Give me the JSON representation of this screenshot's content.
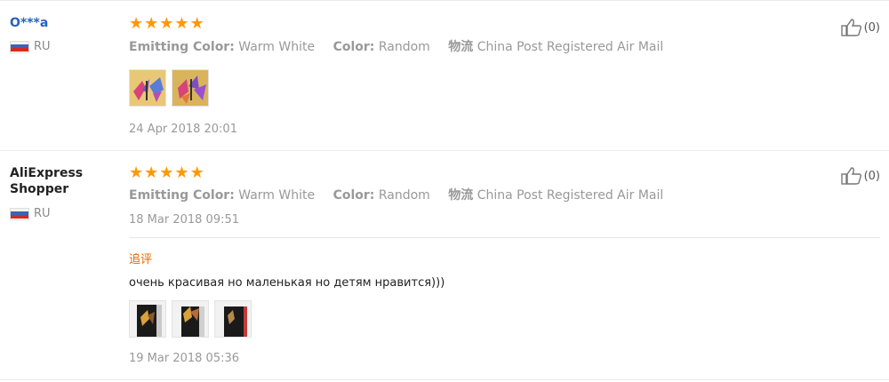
{
  "reviews": [
    {
      "user": "O***a",
      "country": "RU",
      "stars": 5,
      "attributes": [
        {
          "key": "Emitting Color:",
          "value": "Warm White"
        },
        {
          "key": "Color:",
          "value": "Random"
        },
        {
          "key": "物流",
          "value": "China Post Registered Air Mail"
        }
      ],
      "date": "24 Apr 2018 20:01",
      "helpful_count": "(0)",
      "images": [
        "butterfly-photo-1",
        "butterfly-photo-2"
      ]
    },
    {
      "user": "AliExpress Shopper",
      "country": "RU",
      "stars": 5,
      "attributes": [
        {
          "key": "Emitting Color:",
          "value": "Warm White"
        },
        {
          "key": "Color:",
          "value": "Random"
        },
        {
          "key": "物流",
          "value": "China Post Registered Air Mail"
        }
      ],
      "date": "18 Mar 2018 09:51",
      "helpful_count": "(0)",
      "followup": {
        "label": "追评",
        "text": "очень красивая но маленькая но детям нравится)))",
        "images": [
          "nightlight-photo-1",
          "nightlight-photo-2",
          "nightlight-photo-3"
        ],
        "date": "19 Mar 2018 05:36"
      }
    }
  ],
  "colors": {
    "star": "#ff9900",
    "username_link": "#2b62bc",
    "followup_label": "#e56600",
    "muted_text": "#999999"
  },
  "icons": {
    "rating": "star-icon",
    "helpful": "thumbs-up-icon",
    "country": "russia-flag-icon"
  }
}
